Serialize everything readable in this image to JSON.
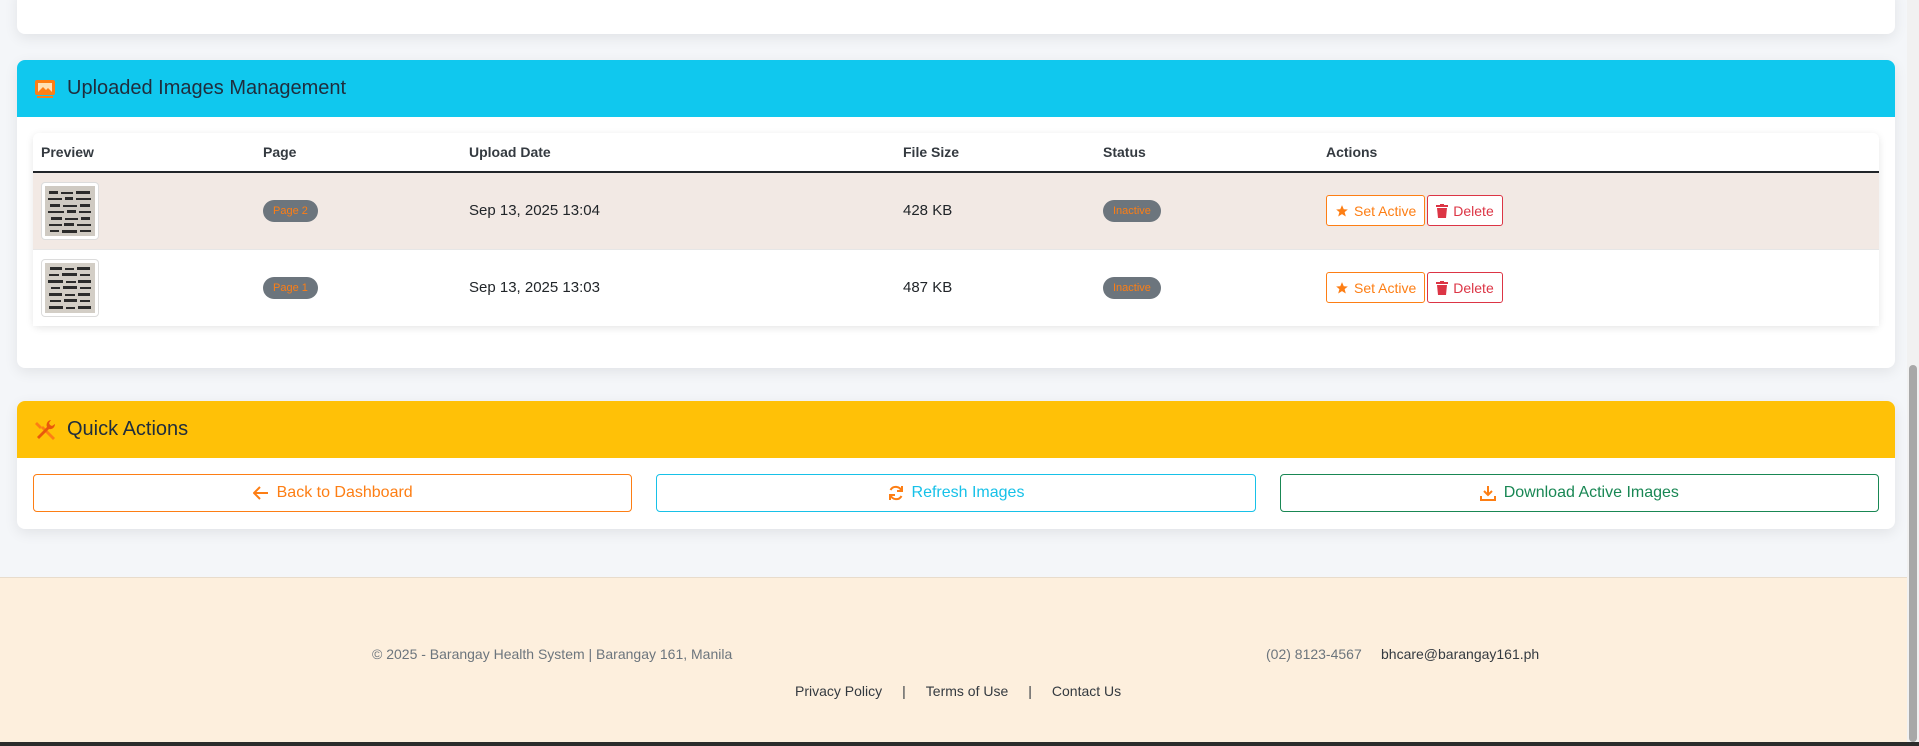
{
  "images_card": {
    "title": "Uploaded Images Management",
    "columns": [
      "Preview",
      "Page",
      "Upload Date",
      "File Size",
      "Status",
      "Actions"
    ],
    "rows": [
      {
        "page": "Page 2",
        "date": "Sep 13, 2025 13:04",
        "size": "428 KB",
        "status": "Inactive",
        "set_active": "Set Active",
        "delete": "Delete"
      },
      {
        "page": "Page 1",
        "date": "Sep 13, 2025 13:03",
        "size": "487 KB",
        "status": "Inactive",
        "set_active": "Set Active",
        "delete": "Delete"
      }
    ]
  },
  "quick_actions": {
    "title": "Quick Actions",
    "back": "Back to Dashboard",
    "refresh": "Refresh Images",
    "download": "Download Active Images"
  },
  "footer": {
    "copyright": "© 2025 - Barangay Health System | Barangay 161, Manila",
    "phone": "(02) 8123-4567",
    "email": "bhcare@barangay161.ph",
    "links": [
      "Privacy Policy",
      "Terms of Use",
      "Contact Us"
    ],
    "separator": "|"
  },
  "icons": {
    "images_header": "images-icon",
    "quick_actions_header": "tools-icon",
    "set_active": "star-icon",
    "delete": "trash-icon",
    "back": "arrow-left-icon",
    "refresh": "refresh-icon",
    "download": "download-icon"
  },
  "colors": {
    "cyan_header": "#10c8ee",
    "amber_header": "#ffc107",
    "orange": "#fd7e14",
    "red": "#dc3545",
    "green": "#198754",
    "footer_bg": "#fdefdd"
  }
}
